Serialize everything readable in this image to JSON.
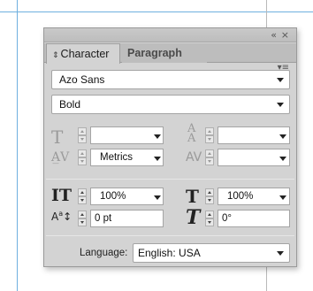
{
  "panel": {
    "collapse_icon": "double-chevron-right-icon",
    "close_icon": "close-icon",
    "collapse_glyph": "«",
    "close_glyph": "×",
    "menu_glyph": "▾≡"
  },
  "tabs": [
    {
      "label": "Character",
      "active": true
    },
    {
      "label": "Paragraph",
      "active": false
    }
  ],
  "font": {
    "family": "Azo Sans",
    "style": "Bold"
  },
  "controls": {
    "font_size": "",
    "leading": "",
    "kerning": "Metrics",
    "tracking": "",
    "vertical_scale": "100%",
    "horizontal_scale": "100%",
    "baseline_shift": "0 pt",
    "skew": "0°"
  },
  "language": {
    "label": "Language:",
    "value": "English: USA"
  }
}
